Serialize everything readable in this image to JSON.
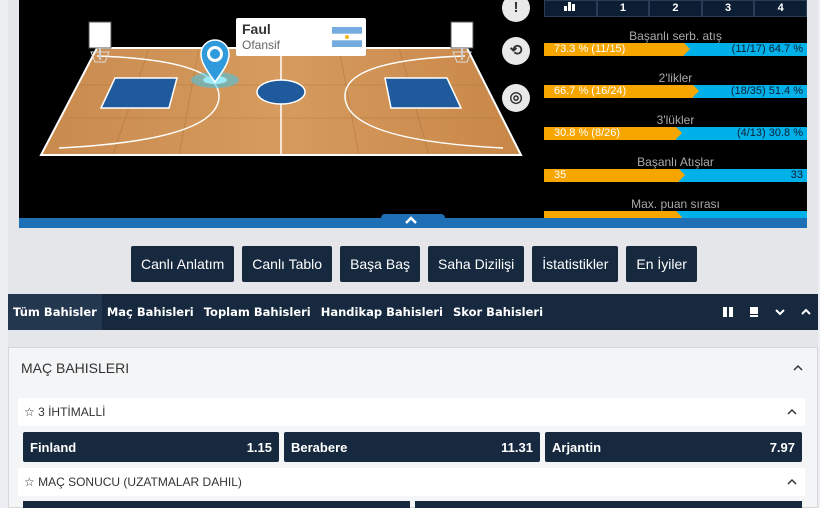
{
  "popup": {
    "title": "Faul",
    "subtitle": "Ofansif"
  },
  "side_buttons": [
    {
      "icon": "exclamation-icon",
      "glyph": "!"
    },
    {
      "icon": "share-icon",
      "glyph": "⟲"
    },
    {
      "icon": "target-icon",
      "glyph": "◎"
    }
  ],
  "quarter_tabs": [
    "",
    "1",
    "2",
    "3",
    "4"
  ],
  "stats": [
    {
      "title": "Başanlı serb. atış",
      "left": "73.3 % (11/15)",
      "right": "(11/17) 64.7 %",
      "left_share": 0.531
    },
    {
      "title": "2'likler",
      "left": "66.7 % (16/24)",
      "right": "(18/35) 51.4 %",
      "left_share": 0.565
    },
    {
      "title": "3'lükler",
      "left": "30.8 % (8/26)",
      "right": "(4/13) 30.8 %",
      "left_share": 0.5
    },
    {
      "title": "Başanlı Atışlar",
      "left": "35",
      "right": "33",
      "left_share": 0.515
    },
    {
      "title": "Max. puan sırası",
      "left": "",
      "right": "",
      "left_share": 0.5
    }
  ],
  "buttons": [
    "Canlı Anlatım",
    "Canlı Tablo",
    "Başa Baş",
    "Saha Dizilişi",
    "İstatistikler",
    "En İyiler"
  ],
  "nav_tabs": [
    "Tüm Bahisler",
    "Maç Bahisleri",
    "Toplam Bahisleri",
    "Handikap Bahisleri",
    "Skor Bahisleri"
  ],
  "panel": {
    "title": "MAÇ BAHISLERI"
  },
  "markets": [
    {
      "title": "☆ 3 İHTİMALLİ",
      "odds": [
        {
          "name": "Finland",
          "value": "1.15"
        },
        {
          "name": "Berabere",
          "value": "11.31"
        },
        {
          "name": "Arjantin",
          "value": "7.97"
        }
      ]
    },
    {
      "title": "☆ MAÇ SONUCU (UZATMALAR DAHIL)",
      "odds": []
    }
  ],
  "colors": {
    "navy": "#16293f",
    "orange": "#f7a600",
    "cyan": "#00b0e8",
    "court_blue": "#1e5a9c"
  }
}
